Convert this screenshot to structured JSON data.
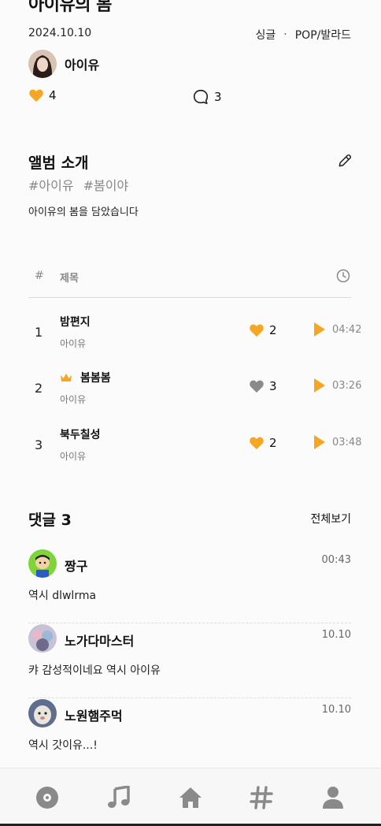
{
  "album": {
    "title": "아이유의 봄",
    "date": "2024.10.10",
    "type": "싱글",
    "genre": "POP/발라드",
    "artist": "아이유",
    "likes": "4",
    "comments": "3"
  },
  "intro": {
    "title": "앨범 소개",
    "tags": [
      "#아이유",
      "#봄이야"
    ],
    "text": "아이유의 봄을 담았습니다"
  },
  "table": {
    "num_header": "#",
    "title_header": "제목"
  },
  "tracks": [
    {
      "num": "1",
      "title": "밤편지",
      "artist": "아이유",
      "likes": "2",
      "liked": true,
      "time": "04:42",
      "title_track": false
    },
    {
      "num": "2",
      "title": "봄봄봄",
      "artist": "아이유",
      "likes": "3",
      "liked": false,
      "time": "03:26",
      "title_track": true
    },
    {
      "num": "3",
      "title": "북두칠성",
      "artist": "아이유",
      "likes": "2",
      "liked": true,
      "time": "03:48",
      "title_track": false
    }
  ],
  "comments_section": {
    "title": "댓글 3",
    "view_all": "전체보기",
    "items": [
      {
        "author": "짱구",
        "time": "00:43",
        "text": "역시 dlwlrma"
      },
      {
        "author": "노가다마스터",
        "time": "10.10",
        "text": "캬 감성적이네요 역시 아이유"
      },
      {
        "author": "노원햄주먹",
        "time": "10.10",
        "text": "역시 갓이유...!"
      }
    ]
  },
  "colors": {
    "accent": "#f5a623",
    "muted_heart": "#8a8a8a",
    "text_gray": "#888888"
  },
  "icons": {
    "like": "heart-icon",
    "comment": "comment-bubble-icon",
    "edit": "pencil-icon",
    "clock": "clock-icon",
    "play": "play-icon",
    "crown": "crown-icon",
    "nav": [
      "album-disc-icon",
      "music-note-icon",
      "home-icon",
      "hashtag-icon",
      "profile-icon"
    ]
  }
}
